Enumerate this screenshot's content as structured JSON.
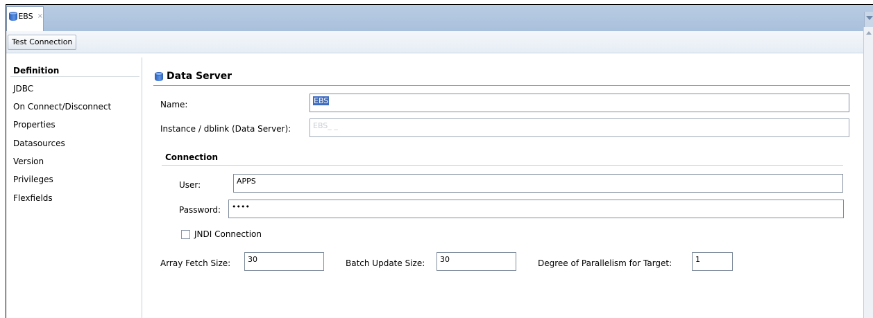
{
  "tab": {
    "label": "EBS",
    "close": "×"
  },
  "toolbar": {
    "test_connection": "Test Connection"
  },
  "nav": {
    "items": [
      {
        "label": "Definition"
      },
      {
        "label": "JDBC"
      },
      {
        "label": "On Connect/Disconnect"
      },
      {
        "label": "Properties"
      },
      {
        "label": "Datasources"
      },
      {
        "label": "Version"
      },
      {
        "label": "Privileges"
      },
      {
        "label": "Flexfields"
      }
    ]
  },
  "data_server": {
    "title": "Data Server",
    "name_label": "Name:",
    "name_value": "EBS",
    "instance_label": "Instance / dblink (Data Server):",
    "instance_value": "EBS_ _"
  },
  "connection": {
    "title": "Connection",
    "user_label": "User:",
    "user_value": "APPS",
    "password_label": "Password:",
    "password_value": "••••",
    "jndi_label": "JNDI Connection"
  },
  "options": {
    "array_fetch_label": "Array Fetch Size:",
    "array_fetch_value": "30",
    "batch_update_label": "Batch Update Size:",
    "batch_update_value": "30",
    "parallelism_label": "Degree of Parallelism for Target:",
    "parallelism_value": "1"
  },
  "colors": {
    "tab_strip": "#b9cde3",
    "selection": "#3d6bbf",
    "icon_blue": "#2b5fb8"
  }
}
